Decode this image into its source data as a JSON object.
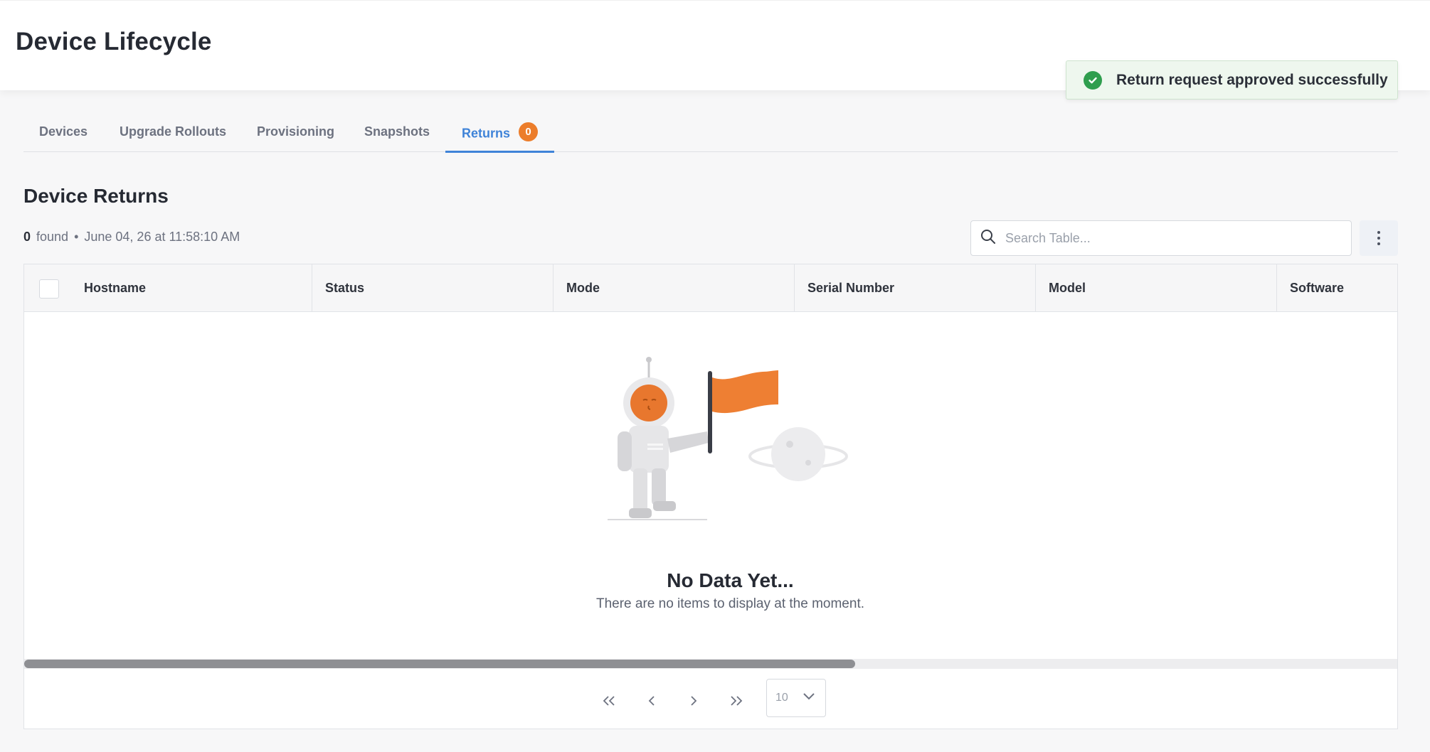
{
  "header": {
    "title": "Device Lifecycle"
  },
  "toast": {
    "message": "Return request approved successfully",
    "icon": "check-circle-icon",
    "color": "#2f9e4e"
  },
  "tabs": [
    {
      "label": "Devices"
    },
    {
      "label": "Upgrade Rollouts"
    },
    {
      "label": "Provisioning"
    },
    {
      "label": "Snapshots"
    },
    {
      "label": "Returns",
      "badge": "0",
      "active": true
    }
  ],
  "section": {
    "title": "Device Returns",
    "count": "0",
    "found_label": "found",
    "separator": "•",
    "timestamp": "June 04, 26 at 11:58:10 AM"
  },
  "search": {
    "placeholder": "Search Table..."
  },
  "table": {
    "columns": [
      "Hostname",
      "Status",
      "Mode",
      "Serial Number",
      "Model",
      "Software"
    ]
  },
  "empty_state": {
    "title": "No Data Yet...",
    "subtitle": "There are no items to display at the moment."
  },
  "pagination": {
    "page_size": "10"
  },
  "colors": {
    "accent": "#3f83d8",
    "badge": "#ec7d2b",
    "success": "#2f9e4e"
  }
}
